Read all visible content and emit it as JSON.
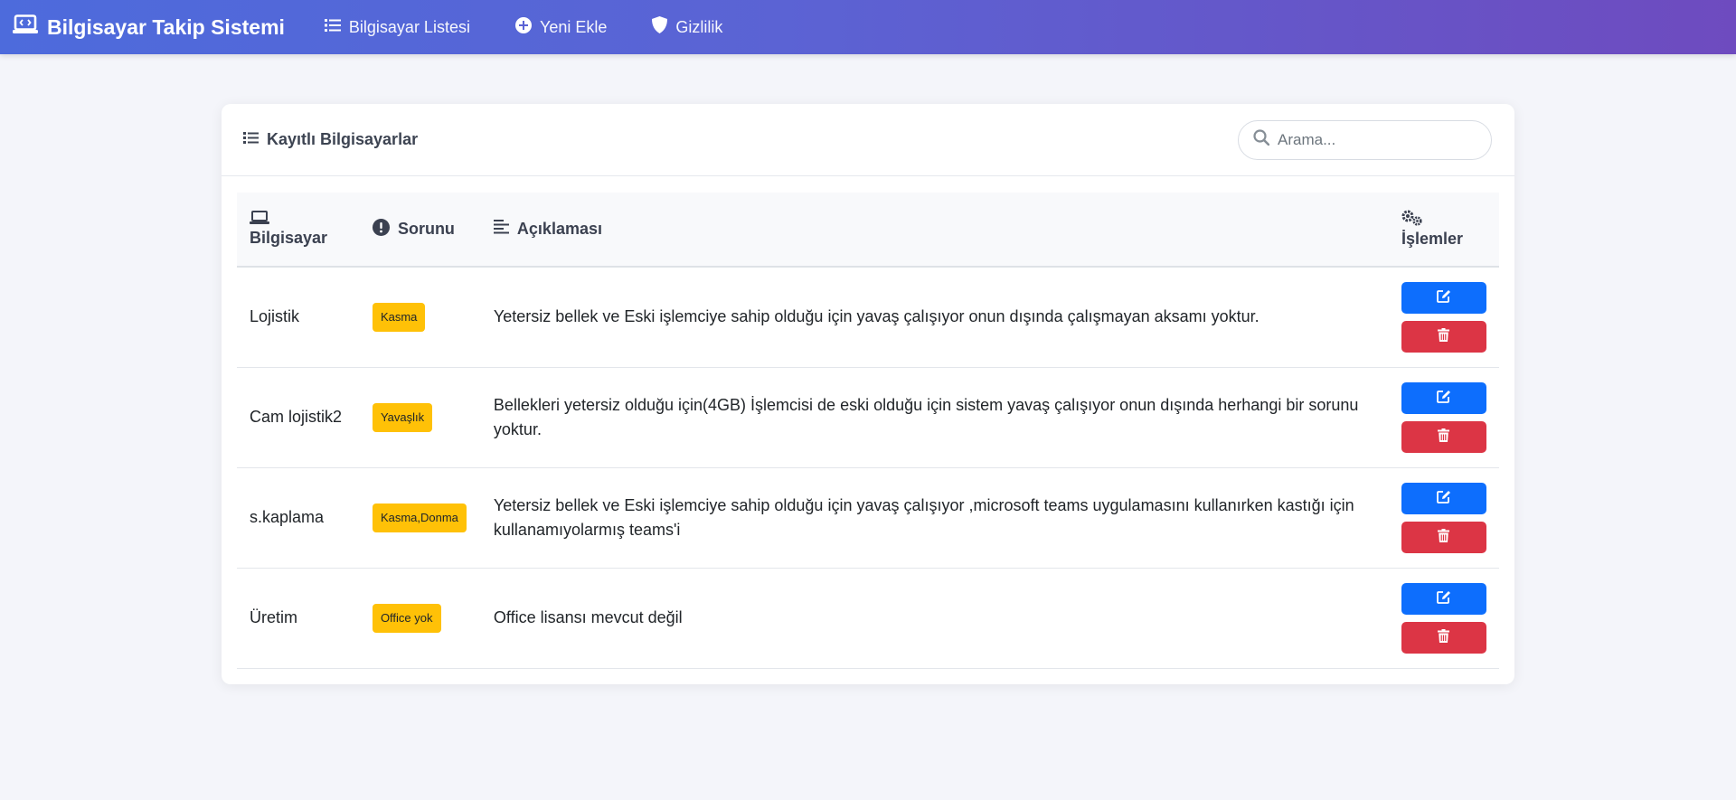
{
  "navbar": {
    "brand": "Bilgisayar Takip Sistemi",
    "links": [
      {
        "label": "Bilgisayar Listesi",
        "icon": "list-icon"
      },
      {
        "label": "Yeni Ekle",
        "icon": "plus-circle-icon"
      },
      {
        "label": "Gizlilik",
        "icon": "shield-icon"
      }
    ]
  },
  "card": {
    "title": "Kayıtlı Bilgisayarlar",
    "search_placeholder": "Arama..."
  },
  "table": {
    "columns": [
      {
        "label": "Bilgisayar",
        "icon": "laptop-icon"
      },
      {
        "label": "Sorunu",
        "icon": "exclamation-circle-icon"
      },
      {
        "label": "Açıklaması",
        "icon": "align-left-icon"
      },
      {
        "label": "İşlemler",
        "icon": "cogs-icon"
      }
    ],
    "rows": [
      {
        "computer": "Lojistik",
        "issue": "Kasma",
        "description": "Yetersiz bellek ve Eski işlemciye sahip olduğu için yavaş çalışıyor onun dışında çalışmayan aksamı yoktur."
      },
      {
        "computer": "Cam lojistik2",
        "issue": "Yavaşlık",
        "description": "Bellekleri yetersiz olduğu için(4GB) İşlemcisi de eski olduğu için sistem yavaş çalışıyor onun dışında herhangi bir sorunu yoktur."
      },
      {
        "computer": "s.kaplama",
        "issue": "Kasma,Donma",
        "description": "Yetersiz bellek ve Eski işlemciye sahip olduğu için yavaş çalışıyor ,microsoft teams uygulamasını kullanırken kastığı için kullanamıyolarmış teams'i"
      },
      {
        "computer": "Üretim",
        "issue": "Office yok",
        "description": "Office lisansı mevcut değil"
      }
    ]
  },
  "colors": {
    "navbar_start": "#4d6bdc",
    "navbar_end": "#6e4bbf",
    "badge": "#ffc107",
    "edit_button": "#0d6efd",
    "delete_button": "#dc3545"
  }
}
